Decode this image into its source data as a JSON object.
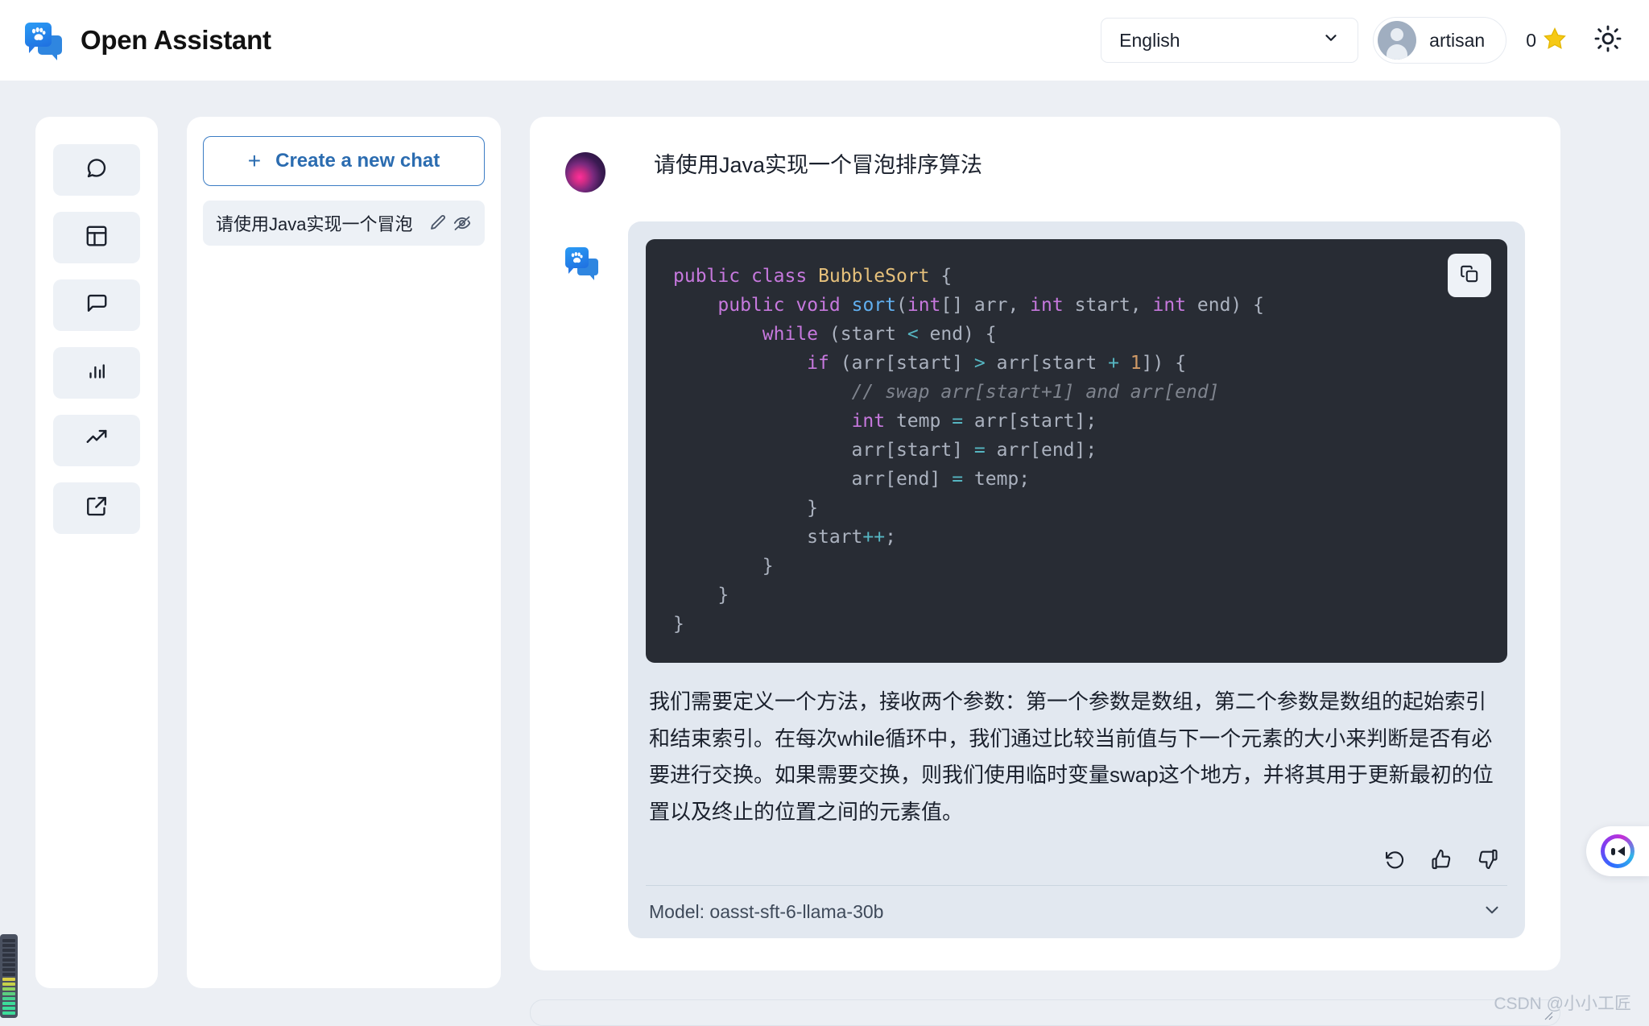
{
  "header": {
    "brand_title": "Open Assistant",
    "logo_icon": "open-assistant-paw-logo",
    "language_value": "English",
    "language_chevron_icon": "chevron-down-icon",
    "user_name": "artisan",
    "avatar_icon": "user-avatar-icon",
    "score_value": "0",
    "star_icon": "star-icon",
    "theme_toggle_icon": "sun-icon"
  },
  "nav_rail": {
    "items": [
      {
        "icon": "message-circle-icon",
        "name": "sidebar-item-chat"
      },
      {
        "icon": "dashboard-layout-icon",
        "name": "sidebar-item-dashboard"
      },
      {
        "icon": "message-square-icon",
        "name": "sidebar-item-messages"
      },
      {
        "icon": "bar-chart-icon",
        "name": "sidebar-item-stats"
      },
      {
        "icon": "trending-up-icon",
        "name": "sidebar-item-leaderboard"
      },
      {
        "icon": "external-link-icon",
        "name": "sidebar-item-external"
      }
    ]
  },
  "chat_panel": {
    "new_chat_label": "Create a new chat",
    "new_chat_plus": "+",
    "items": [
      {
        "label": "请使用Java实现一个冒泡",
        "edit_icon": "pencil-icon",
        "hide_icon": "eye-off-icon"
      }
    ]
  },
  "conversation": {
    "user_message": "请使用Java实现一个冒泡排序算法",
    "assistant": {
      "copy_icon": "copy-icon",
      "code_lines": [
        [
          {
            "t": "public",
            "c": "kw"
          },
          {
            "t": " ",
            "c": "pl"
          },
          {
            "t": "class",
            "c": "kw"
          },
          {
            "t": " ",
            "c": "pl"
          },
          {
            "t": "BubbleSort",
            "c": "cls"
          },
          {
            "t": " {",
            "c": "pl"
          }
        ],
        [
          {
            "t": "    ",
            "c": "pl"
          },
          {
            "t": "public",
            "c": "kw"
          },
          {
            "t": " ",
            "c": "pl"
          },
          {
            "t": "void",
            "c": "kw"
          },
          {
            "t": " ",
            "c": "pl"
          },
          {
            "t": "sort",
            "c": "fn"
          },
          {
            "t": "(",
            "c": "pl"
          },
          {
            "t": "int",
            "c": "kw"
          },
          {
            "t": "[] arr, ",
            "c": "pl"
          },
          {
            "t": "int",
            "c": "kw"
          },
          {
            "t": " start, ",
            "c": "pl"
          },
          {
            "t": "int",
            "c": "kw"
          },
          {
            "t": " end) {",
            "c": "pl"
          }
        ],
        [
          {
            "t": "        ",
            "c": "pl"
          },
          {
            "t": "while",
            "c": "kw"
          },
          {
            "t": " (start ",
            "c": "pl"
          },
          {
            "t": "<",
            "c": "op"
          },
          {
            "t": " end) {",
            "c": "pl"
          }
        ],
        [
          {
            "t": "            ",
            "c": "pl"
          },
          {
            "t": "if",
            "c": "kw"
          },
          {
            "t": " (arr[start] ",
            "c": "pl"
          },
          {
            "t": ">",
            "c": "op"
          },
          {
            "t": " arr[start ",
            "c": "pl"
          },
          {
            "t": "+",
            "c": "op"
          },
          {
            "t": " ",
            "c": "pl"
          },
          {
            "t": "1",
            "c": "num"
          },
          {
            "t": "]) {",
            "c": "pl"
          }
        ],
        [
          {
            "t": "                ",
            "c": "pl"
          },
          {
            "t": "// swap arr[start+1] and arr[end]",
            "c": "cmt"
          }
        ],
        [
          {
            "t": "                ",
            "c": "pl"
          },
          {
            "t": "int",
            "c": "kw"
          },
          {
            "t": " temp ",
            "c": "pl"
          },
          {
            "t": "=",
            "c": "op"
          },
          {
            "t": " arr[start];",
            "c": "pl"
          }
        ],
        [
          {
            "t": "                arr[start] ",
            "c": "pl"
          },
          {
            "t": "=",
            "c": "op"
          },
          {
            "t": " arr[end];",
            "c": "pl"
          }
        ],
        [
          {
            "t": "                arr[end] ",
            "c": "pl"
          },
          {
            "t": "=",
            "c": "op"
          },
          {
            "t": " temp;",
            "c": "pl"
          }
        ],
        [
          {
            "t": "            }",
            "c": "pl"
          }
        ],
        [
          {
            "t": "            start",
            "c": "pl"
          },
          {
            "t": "++",
            "c": "op"
          },
          {
            "t": ";",
            "c": "pl"
          }
        ],
        [
          {
            "t": "        }",
            "c": "pl"
          }
        ],
        [
          {
            "t": "    }",
            "c": "pl"
          }
        ],
        [
          {
            "t": "}",
            "c": "pl"
          }
        ]
      ],
      "explanation": "我们需要定义一个方法，接收两个参数：第一个参数是数组，第二个参数是数组的起始索引和结束索引。在每次while循环中，我们通过比较当前值与下一个元素的大小来判断是否有必要进行交换。如果需要交换，则我们使用临时变量swap这个地方，并将其用于更新最初的位置以及终止的位置之间的元素值。",
      "actions": [
        {
          "icon": "retry-icon",
          "name": "retry-button"
        },
        {
          "icon": "thumbs-up-icon",
          "name": "thumbs-up-button"
        },
        {
          "icon": "thumbs-down-icon",
          "name": "thumbs-down-button"
        }
      ],
      "model_label": "Model: oasst-sft-6-llama-30b",
      "model_chevron_icon": "chevron-down-icon"
    },
    "composer_placeholder": ""
  },
  "floating": {
    "intercom_icon": "intercom-chat-face-icon",
    "equalizer_icon": "audio-level-meter-icon"
  },
  "watermark": "CSDN @小小工匠",
  "colors": {
    "brand_blue": "#2578e4",
    "link_blue": "#2b6cb0",
    "page_bg": "#eceff4",
    "bubble_bg": "#e2e8f0",
    "code_bg": "#282c34",
    "star_gold": "#f6c915"
  }
}
